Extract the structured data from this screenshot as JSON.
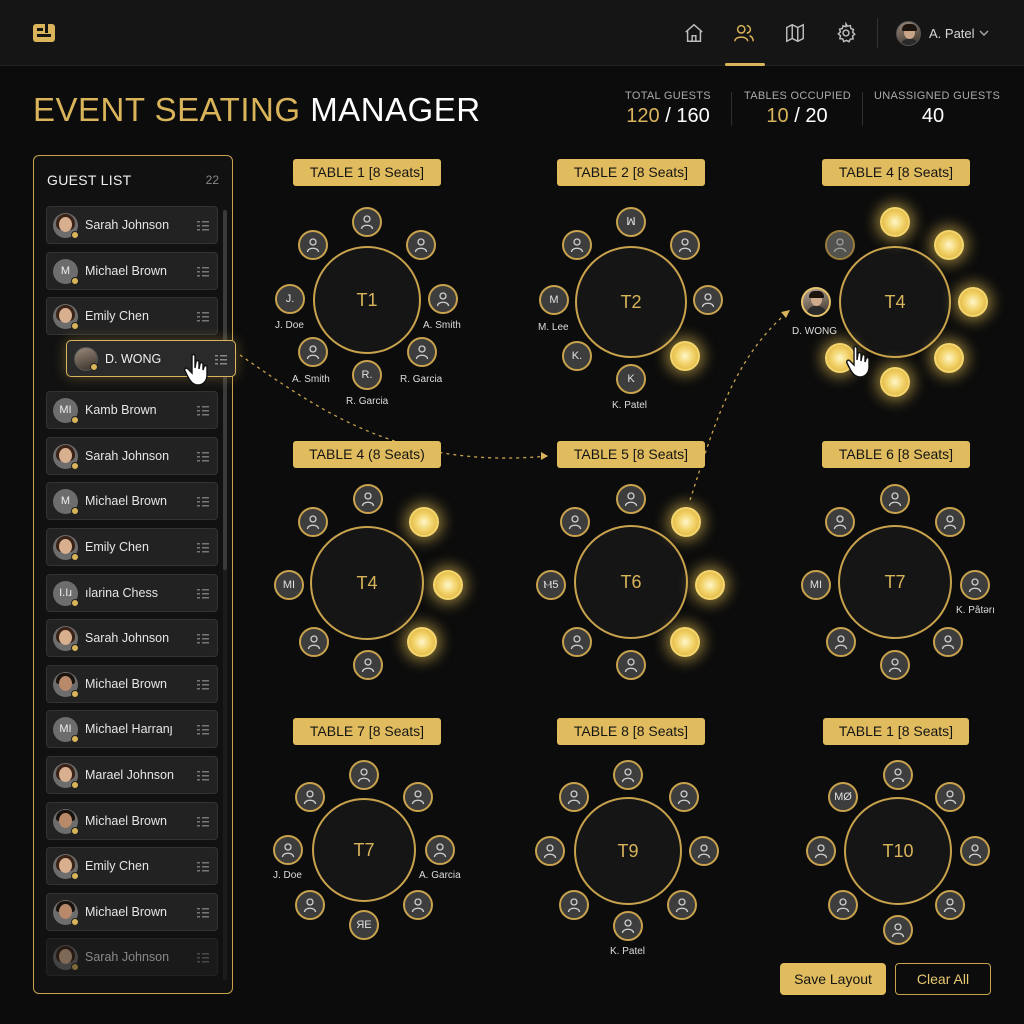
{
  "header": {
    "nav_items": [
      {
        "name": "home",
        "icon": "home-icon"
      },
      {
        "name": "guests",
        "icon": "users-icon",
        "active": true
      },
      {
        "name": "map",
        "icon": "map-icon"
      },
      {
        "name": "settings",
        "icon": "gear-icon"
      }
    ],
    "user": {
      "name": "A. Patel"
    }
  },
  "title": {
    "part1": "EVENT SEATING",
    "part2": "MANAGER"
  },
  "stats": {
    "total_label": "TOTAL GUESTS",
    "total_value": "120",
    "total_max": "/ 160",
    "tables_label": "TABLES OCCUPIED",
    "tables_value": "10",
    "tables_max": "/ 20",
    "unassigned_label": "UNASSIGNED GUESTS",
    "unassigned_value": "40"
  },
  "guest_list": {
    "title": "GUEST LIST",
    "count": "22",
    "items": [
      {
        "name": "Sarah Johnson",
        "avatar": "photo-female"
      },
      {
        "name": "Michael Brown",
        "avatar": "initial",
        "initial": "M"
      },
      {
        "name": "Emily Chen",
        "avatar": "photo-female"
      },
      {
        "name": "Kamb Brown",
        "avatar": "initial",
        "initial": "MI"
      },
      {
        "name": "Sarah Johnson",
        "avatar": "photo-female"
      },
      {
        "name": "Michael Brown",
        "avatar": "initial",
        "initial": "M"
      },
      {
        "name": "Emily Chen",
        "avatar": "photo-female"
      },
      {
        "name": "ılarina Chess",
        "avatar": "initial",
        "initial": "I.Iɹ"
      },
      {
        "name": "Sarah Johnson",
        "avatar": "photo-female"
      },
      {
        "name": "Michael Brown",
        "avatar": "photo-male"
      },
      {
        "name": "Michael Harranȷ",
        "avatar": "initial",
        "initial": "MI"
      },
      {
        "name": "Marael Johnson",
        "avatar": "photo-female"
      },
      {
        "name": "Michael Brown",
        "avatar": "photo-male"
      },
      {
        "name": "Emily Chen",
        "avatar": "photo-female"
      },
      {
        "name": "Michael Brown",
        "avatar": "photo-male"
      },
      {
        "name": "Sarah Johnson",
        "avatar": "photo-female"
      }
    ]
  },
  "dragged_guest": {
    "name": "D. WONG"
  },
  "tables": [
    {
      "label": "TABLE 1 [8 Seats]",
      "center": "T1"
    },
    {
      "label": "TABLE 2 [8 Seats]",
      "center": "T2"
    },
    {
      "label": "TABLE 4 [8 Seats]",
      "center": "T4"
    },
    {
      "label": "TABLE 4 (8 Seats)",
      "center": "T4"
    },
    {
      "label": "TABLE 5 [8 Seats]",
      "center": "T6"
    },
    {
      "label": "TABLE 6 [8 Seats]",
      "center": "T7"
    },
    {
      "label": "TABLE 7 [8 Seats]",
      "center": "T7"
    },
    {
      "label": "TABLE 8 [8 Seats]",
      "center": "T9"
    },
    {
      "label": "TABLE 1 [8 Seats]",
      "center": "T10"
    }
  ],
  "seat_texts": {
    "t1_left": "J.",
    "t1_bottom": "R.",
    "t2_top": "ꟽ",
    "t2_left": "M",
    "t2_bl": "K.",
    "t2_bottom": "K",
    "t4b_left": "MI",
    "t5_left": "Ⲙ5",
    "t6_left": "MI",
    "t8_bottom": "ЯE",
    "t10_tl": "MØ"
  },
  "seat_labels": {
    "t1_left": "J. Doe",
    "t1_right": "A. Smith",
    "t1_bl": "A. Smith",
    "t1_br": "R. Garcia",
    "t1_bottom": "R. Garcia",
    "t2_left": "M. Lee",
    "t2_bottom": "K. Patel",
    "t3_left": "D. WONG",
    "t6_right": "K. Pâtərı",
    "t7_left": "J. Doe",
    "t7_right": "A. Garcia",
    "t8_bottom": "K. Patel"
  },
  "buttons": {
    "save": "Save Layout",
    "clear": "Clear All"
  },
  "colors": {
    "accent": "#d9b45a",
    "background": "#0c0c0c",
    "panel": "#111111"
  }
}
